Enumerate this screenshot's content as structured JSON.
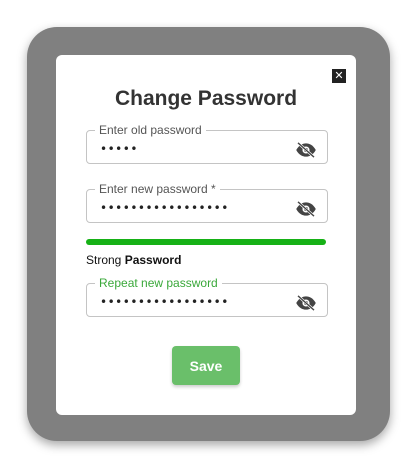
{
  "dialog": {
    "close_label": "✕",
    "title": "Change Password"
  },
  "fields": {
    "old": {
      "label": "Enter old password",
      "value": "•••••"
    },
    "new": {
      "label": "Enter new password *",
      "value": "•••••••••••••••••"
    },
    "repeat": {
      "label": "Repeat new password",
      "value": "•••••••••••••••••"
    }
  },
  "strength": {
    "level_prefix": "Strong",
    "suffix": "Password",
    "fill_percent": 100,
    "color": "#16b116"
  },
  "actions": {
    "save_label": "Save"
  },
  "colors": {
    "accent_green": "#6abf6a",
    "frame_gray": "#808080"
  },
  "icons": {
    "visibility": "eye-slash-icon",
    "close": "close-icon"
  }
}
